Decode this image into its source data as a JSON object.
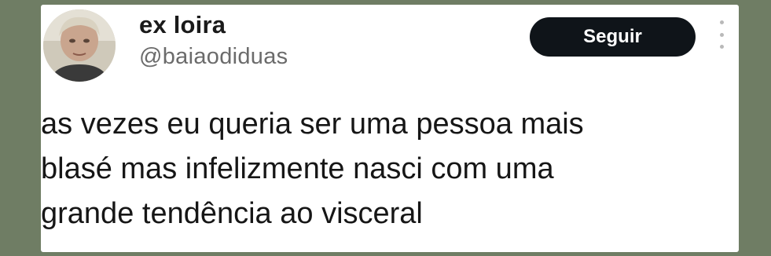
{
  "tweet": {
    "author": {
      "display_name": "ex loira",
      "handle": "@baiaodiduas",
      "avatar_icon": "profile-photo"
    },
    "follow_button_label": "Seguir",
    "more_icon": "more-vertical-icon",
    "text_lines": [
      "as vezes eu queria ser uma pessoa mais",
      "blasé mas infelizmente nasci com uma",
      "grande tendência ao visceral"
    ]
  },
  "colors": {
    "background": "#6f7d64",
    "card": "#ffffff",
    "button": "#0f1419",
    "button_text": "#ffffff",
    "handle": "#6b6b6b"
  }
}
